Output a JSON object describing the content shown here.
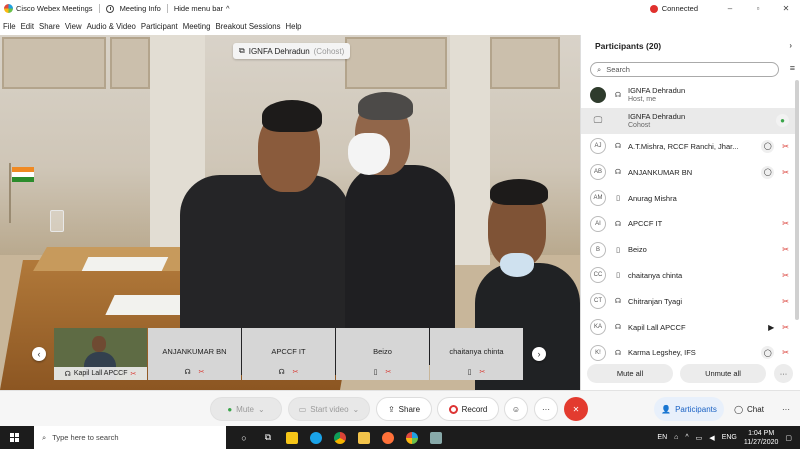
{
  "titlebar": {
    "app_title": "Cisco Webex Meetings",
    "meeting_info": "Meeting Info",
    "hide_menu_bar": "Hide menu bar",
    "hide_menu_chevron": "^",
    "status": "Connected",
    "minimize": "–",
    "restore": "▫",
    "close": "✕",
    "status_color": "#e0312d"
  },
  "menu": {
    "file": "File",
    "edit": "Edit",
    "share": "Share",
    "view": "View",
    "audio_video": "Audio & Video",
    "participant": "Participant",
    "meeting": "Meeting",
    "breakout": "Breakout Sessions",
    "help": "Help"
  },
  "video": {
    "speaker_name": "IGNFA Dehradun",
    "speaker_role": "(Cohost)"
  },
  "filmstrip": {
    "tiles": [
      {
        "name": "Kapil Lall APCCF"
      },
      {
        "name": "ANJANKUMAR BN"
      },
      {
        "name": "APCCF IT"
      },
      {
        "name": "Beizo"
      },
      {
        "name": "chaitanya chinta"
      }
    ],
    "prev": "‹",
    "next": "›"
  },
  "participants": {
    "header": "Participants (20)",
    "collapse": "›",
    "search_placeholder": "Search",
    "sort_icon": "≡",
    "rows": [
      {
        "initials": "",
        "name": "IGNFA Dehradun",
        "sub": "Host, me"
      },
      {
        "initials": "",
        "name": "IGNFA Dehradun",
        "sub": "Cohost"
      },
      {
        "initials": "AJ",
        "name": "A.T.Mishra, RCCF Ranchi, Jhar...",
        "sub": ""
      },
      {
        "initials": "AB",
        "name": "ANJANKUMAR BN",
        "sub": ""
      },
      {
        "initials": "AM",
        "name": "Anurag Mishra",
        "sub": ""
      },
      {
        "initials": "AI",
        "name": "APCCF IT",
        "sub": ""
      },
      {
        "initials": "B",
        "name": "Beizo",
        "sub": ""
      },
      {
        "initials": "CC",
        "name": "chaitanya chinta",
        "sub": ""
      },
      {
        "initials": "CT",
        "name": "Chitranjan Tyagi",
        "sub": ""
      },
      {
        "initials": "KA",
        "name": "Kapil Lall APCCF",
        "sub": ""
      },
      {
        "initials": "K!",
        "name": "Karma Legshey, IFS",
        "sub": ""
      }
    ],
    "mute_all": "Mute all",
    "unmute_all": "Unmute all",
    "more": "···"
  },
  "controls": {
    "mute": "Mute",
    "start_video": "Start video",
    "share": "Share",
    "record": "Record",
    "emoji": "☺",
    "more": "···",
    "end": "✕",
    "participants": "Participants",
    "chat": "Chat"
  },
  "taskbar": {
    "search_placeholder": "Type here to search",
    "lang": "EN",
    "input_lang": "ENG",
    "time": "1:04 PM",
    "date": "11/27/2020"
  }
}
